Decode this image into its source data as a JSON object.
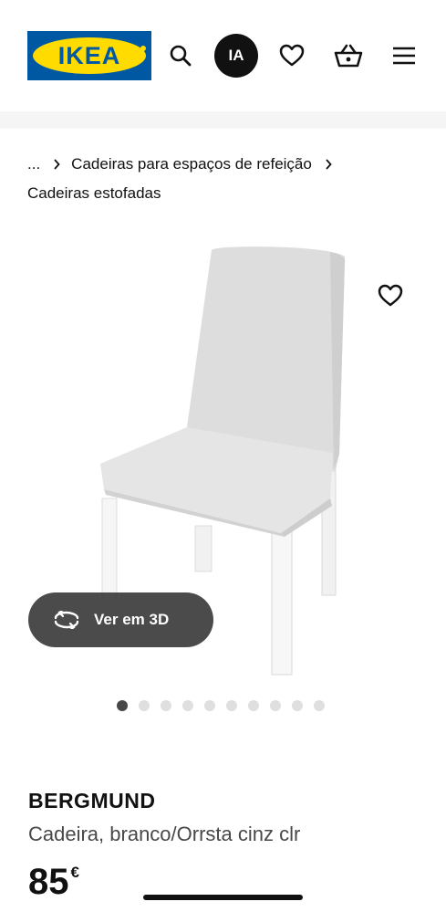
{
  "header": {
    "logo_text": "IKEA",
    "ia_label": "IA",
    "icons": [
      "search-icon",
      "heart-icon",
      "basket-icon",
      "menu-icon"
    ],
    "brand_blue": "#0058a3",
    "brand_yellow": "#ffdb00"
  },
  "breadcrumb": {
    "ellipsis": "...",
    "items": [
      "Cadeiras para espaços de refeição",
      "Cadeiras estofadas"
    ]
  },
  "gallery": {
    "view_3d_label": "Ver em 3D",
    "image_count": 10,
    "active_index": 0
  },
  "product": {
    "name": "BERGMUND",
    "description": "Cadeira, branco/Orrsta cinz clr",
    "price": "85",
    "currency": "€"
  }
}
